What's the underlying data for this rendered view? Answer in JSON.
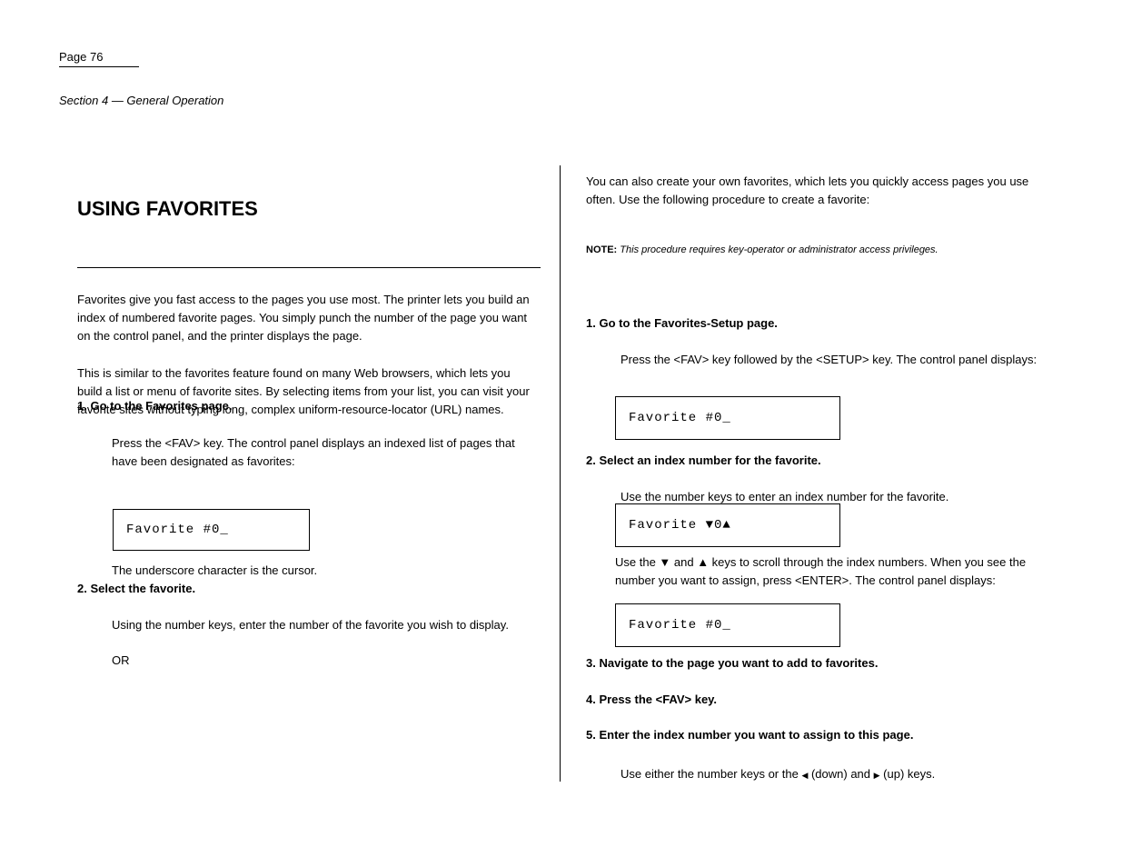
{
  "page": {
    "number": "Page 76",
    "running_header": "Section 4 — General Operation",
    "section_heading": "USING FAVORITES"
  },
  "left": {
    "intro_1": "Favorites give you fast access to the pages you use most. The printer lets you build an index of numbered favorite pages. You simply punch the number of the page you want on the control panel, and the printer displays the page.",
    "intro_2": "This is similar to the favorites feature found on many Web browsers, which lets you build a list or menu of favorite sites. By selecting items from your list, you can visit your favorite sites without typing long, complex uniform-resource-locator (URL) names.",
    "step1_label": "1. Go to the Favorites page.",
    "step1_body": "Press the <FAV> key. The control panel displays an indexed list of pages that have been designated as favorites:",
    "lcd_initial": "Favorite #0_",
    "after_lcd": "The underscore character is the cursor.",
    "step2_label": "2. Select the favorite.",
    "step2_body_a": "Using the number keys, enter the number of the favorite you wish to display.",
    "step2_body_b": "OR"
  },
  "right": {
    "intro": "You can also create your own favorites, which lets you quickly access pages you use often. Use the following procedure to create a favorite:",
    "note_label": "NOTE:",
    "note_body": "This procedure requires key-operator or administrator access privileges.",
    "step1_label": "1. Go to the Favorites-Setup page.",
    "step1_body": "Press the <FAV> key followed by the <SETUP> key. The control panel displays:",
    "lcd1": "Favorite #0_",
    "step2_label": "2. Select an index number for the favorite.",
    "step2_body": "Use the number keys to enter an index number for the favorite.",
    "lcd2": "Favorite ▼0▲",
    "sub1": "Use the ▼ and ▲ keys to scroll through the index numbers. When you see the number you want to assign, press <ENTER>. The control panel displays:",
    "lcd3": "Favorite #0_",
    "step3_label": "3. Navigate to the page you want to add to favorites.",
    "step4_label": "4. Press the <FAV> key.",
    "step5_label": "5. Enter the index number you want to assign to this page.",
    "step6_a": "Use either the number keys or the ",
    "step6_b": " (down) and ",
    "step6_c": " (up) keys."
  }
}
